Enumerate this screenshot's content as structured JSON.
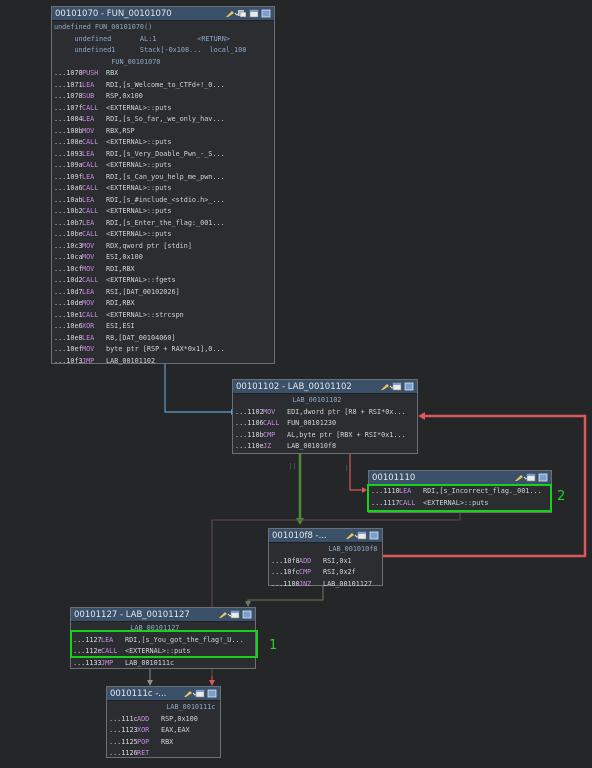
{
  "blocks": {
    "b1070": {
      "title": "00101070 - FUN_00101070",
      "lines": [
        {
          "addr": "",
          "mn": "",
          "op": "undefined FUN_00101070()"
        },
        {
          "addr": "",
          "mn": "",
          "op": "     undefined       AL:1          <RETURN>"
        },
        {
          "addr": "",
          "mn": "",
          "op": "     undefined1      Stack[-0x108...  local_108"
        },
        {
          "addr": "",
          "mn": "",
          "op": "              FUN_00101070"
        },
        {
          "addr": "...1070",
          "mn": "PUSH",
          "op": "RBX"
        },
        {
          "addr": "...1071",
          "mn": "LEA",
          "op": "RDI,[s_Welcome_to_CTFd+!_0..."
        },
        {
          "addr": "...1078",
          "mn": "SUB",
          "op": "RSP,0x100"
        },
        {
          "addr": "...107f",
          "mn": "CALL",
          "op": "<EXTERNAL>::puts"
        },
        {
          "addr": "...1084",
          "mn": "LEA",
          "op": "RDI,[s_So_far,_we_only_hav..."
        },
        {
          "addr": "...108b",
          "mn": "MOV",
          "op": "RBX,RSP"
        },
        {
          "addr": "...108e",
          "mn": "CALL",
          "op": "<EXTERNAL>::puts"
        },
        {
          "addr": "...1093",
          "mn": "LEA",
          "op": "RDI,[s_Very_Doable_Pwn_-_S..."
        },
        {
          "addr": "...109a",
          "mn": "CALL",
          "op": "<EXTERNAL>::puts"
        },
        {
          "addr": "...109f",
          "mn": "LEA",
          "op": "RDI,[s_Can_you_help_me_pwn..."
        },
        {
          "addr": "...10a6",
          "mn": "CALL",
          "op": "<EXTERNAL>::puts"
        },
        {
          "addr": "...10ab",
          "mn": "LEA",
          "op": "RDI,[s_#include_<stdio.h>_..."
        },
        {
          "addr": "...10b2",
          "mn": "CALL",
          "op": "<EXTERNAL>::puts"
        },
        {
          "addr": "...10b7",
          "mn": "LEA",
          "op": "RDI,[s_Enter_the_flag:_001..."
        },
        {
          "addr": "...10be",
          "mn": "CALL",
          "op": "<EXTERNAL>::puts"
        },
        {
          "addr": "...10c3",
          "mn": "MOV",
          "op": "RDX,qword ptr [stdin]"
        },
        {
          "addr": "...10ca",
          "mn": "MOV",
          "op": "ESI,0x100"
        },
        {
          "addr": "...10cf",
          "mn": "MOV",
          "op": "RDI,RBX"
        },
        {
          "addr": "...10d2",
          "mn": "CALL",
          "op": "<EXTERNAL>::fgets"
        },
        {
          "addr": "...10d7",
          "mn": "LEA",
          "op": "RSI,[DAT_00102026]"
        },
        {
          "addr": "...10de",
          "mn": "MOV",
          "op": "RDI,RBX"
        },
        {
          "addr": "...10e1",
          "mn": "CALL",
          "op": "<EXTERNAL>::strcspn"
        },
        {
          "addr": "...10e6",
          "mn": "XOR",
          "op": "ESI,ESI"
        },
        {
          "addr": "...10e8",
          "mn": "LEA",
          "op": "R8,[DAT_00104060]"
        },
        {
          "addr": "...10ef",
          "mn": "MOV",
          "op": "byte ptr [RSP + RAX*0x1],0..."
        },
        {
          "addr": "...10f3",
          "mn": "JMP",
          "op": "LAB_00101102"
        }
      ]
    },
    "b1102": {
      "title": "00101102 - LAB_00101102",
      "lines": [
        {
          "addr": "",
          "mn": "",
          "op": "              LAB_00101102"
        },
        {
          "addr": "...1102",
          "mn": "MOV",
          "op": "EDI,dword ptr [R8 + RSI*0x..."
        },
        {
          "addr": "...1106",
          "mn": "CALL",
          "op": "FUN_00101230"
        },
        {
          "addr": "...110b",
          "mn": "CMP",
          "op": "AL,byte ptr [RBX + RSI*0x1..."
        },
        {
          "addr": "...110e",
          "mn": "JZ",
          "op": "LAB_001010f8"
        }
      ]
    },
    "b1110": {
      "title": "00101110",
      "lines": [
        {
          "addr": "...1110",
          "mn": "LEA",
          "op": "RDI,[s_Incorrect_flag._001..."
        },
        {
          "addr": "...1117",
          "mn": "CALL",
          "op": "<EXTERNAL>::puts"
        }
      ]
    },
    "b10f8": {
      "title": "001010f8 -...",
      "lines": [
        {
          "addr": "",
          "mn": "",
          "op": "              LAB_001010f8"
        },
        {
          "addr": "...10f8",
          "mn": "ADD",
          "op": "RSI,0x1"
        },
        {
          "addr": "...10fc",
          "mn": "CMP",
          "op": "RSI,0x2f"
        },
        {
          "addr": "...1100",
          "mn": "JNZ",
          "op": "LAB_00101127"
        }
      ]
    },
    "b1127": {
      "title": "00101127 - LAB_00101127",
      "lines": [
        {
          "addr": "",
          "mn": "",
          "op": "              LAB_00101127"
        },
        {
          "addr": "...1127",
          "mn": "LEA",
          "op": "RDI,[s_You_got_the_flag!_U..."
        },
        {
          "addr": "...112e",
          "mn": "CALL",
          "op": "<EXTERNAL>::puts"
        },
        {
          "addr": "...1133",
          "mn": "JMP",
          "op": "LAB_0010111c"
        }
      ]
    },
    "b111c": {
      "title": "0010111c -...",
      "lines": [
        {
          "addr": "",
          "mn": "",
          "op": "              LAB_0010111c"
        },
        {
          "addr": "...111c",
          "mn": "ADD",
          "op": "RSP,0x100"
        },
        {
          "addr": "...1123",
          "mn": "XOR",
          "op": "EAX,EAX"
        },
        {
          "addr": "...1125",
          "mn": "POP",
          "op": "RBX"
        },
        {
          "addr": "...1126",
          "mn": "RET",
          "op": ""
        }
      ]
    }
  },
  "annotations": {
    "one": "1",
    "two": "2"
  },
  "colors": {
    "true_edge": "#4c8a3c",
    "false_edge": "#d9585a",
    "flow_edge": "#5a9fd6",
    "highlight": "#17d11d"
  }
}
